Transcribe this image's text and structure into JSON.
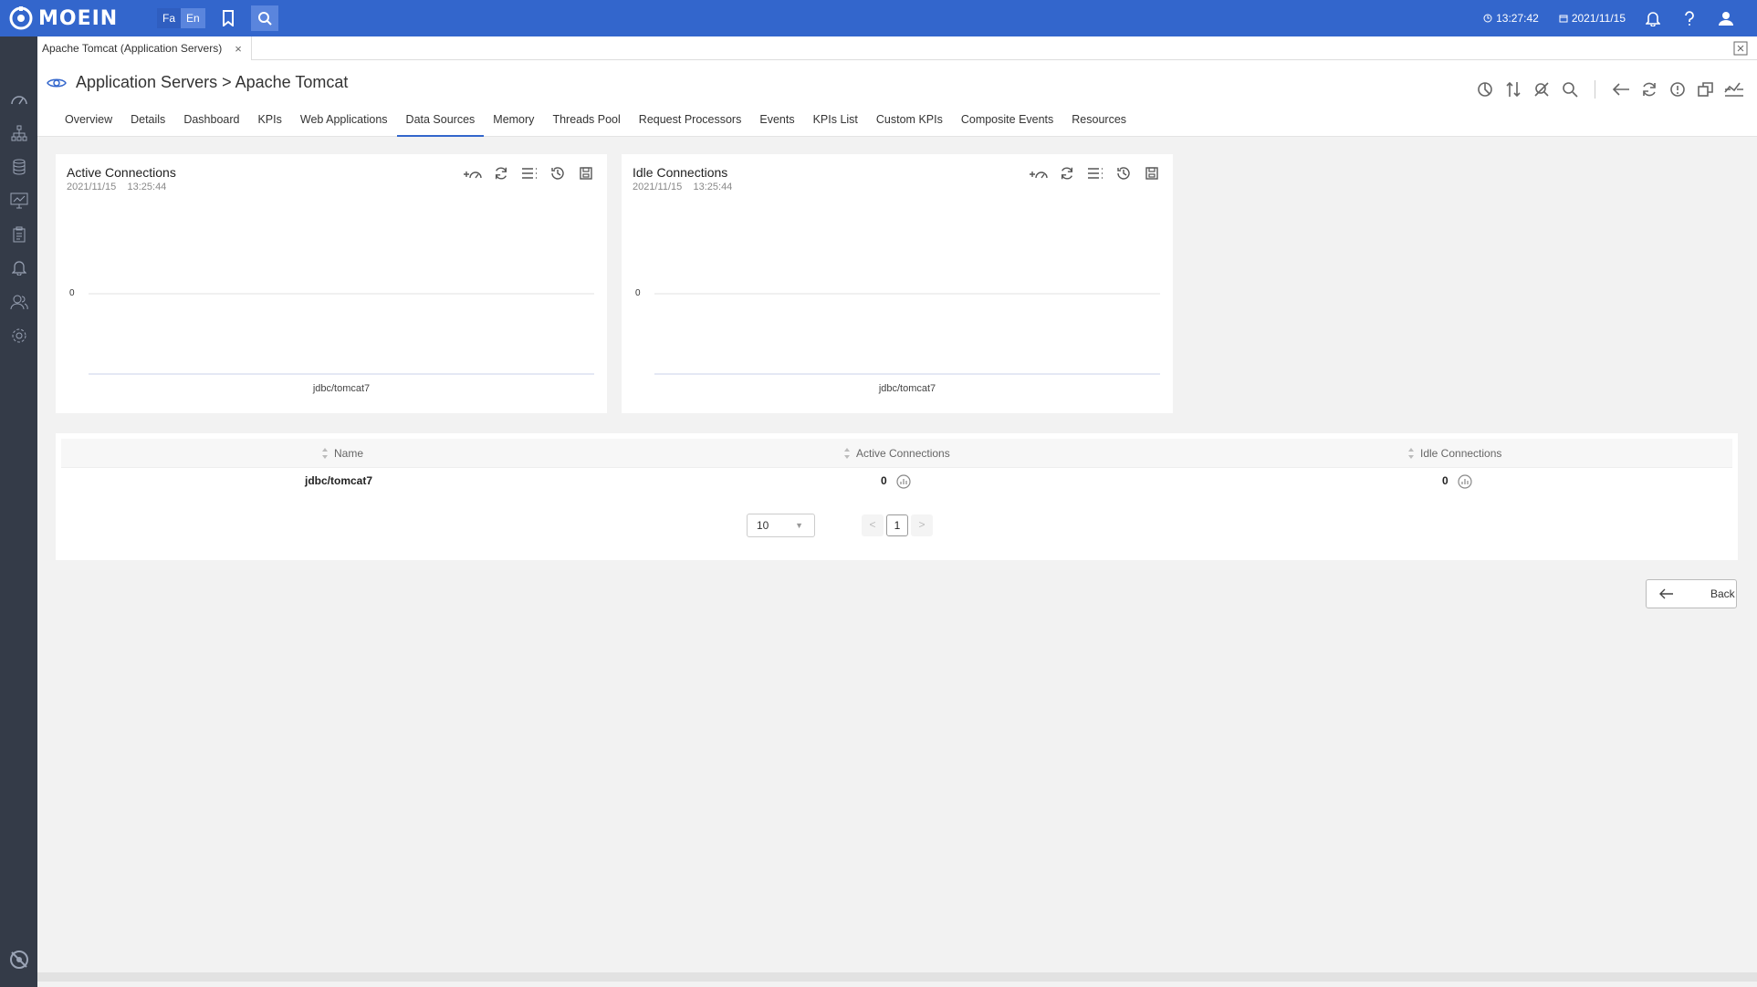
{
  "app": {
    "logo_text": "MOEIN"
  },
  "lang": {
    "fa": "Fa",
    "en": "En"
  },
  "topbar": {
    "time": "13:27:42",
    "date": "2021/11/15"
  },
  "doc_tab": {
    "label": "Apache Tomcat (Application Servers)",
    "close": "×"
  },
  "breadcrumb": "Application Servers > Apache Tomcat",
  "tabs": [
    "Overview",
    "Details",
    "Dashboard",
    "KPIs",
    "Web Applications",
    "Data Sources",
    "Memory",
    "Threads Pool",
    "Request Processors",
    "Events",
    "KPIs List",
    "Custom KPIs",
    "Composite Events",
    "Resources"
  ],
  "active_tab": "Data Sources",
  "charts": [
    {
      "title": "Active Connections",
      "date": "2021/11/15",
      "time": "13:25:44",
      "y_tick": "0",
      "x_label": "jdbc/tomcat7"
    },
    {
      "title": "Idle Connections",
      "date": "2021/11/15",
      "time": "13:25:44",
      "y_tick": "0",
      "x_label": "jdbc/tomcat7"
    }
  ],
  "chart_data": [
    {
      "type": "bar",
      "categories": [
        "jdbc/tomcat7"
      ],
      "values": [
        0
      ],
      "title": "Active Connections",
      "xlabel": "",
      "ylabel": "",
      "y_ticks": [
        0
      ],
      "grid": true
    },
    {
      "type": "bar",
      "categories": [
        "jdbc/tomcat7"
      ],
      "values": [
        0
      ],
      "title": "Idle Connections",
      "xlabel": "",
      "ylabel": "",
      "y_ticks": [
        0
      ],
      "grid": true
    }
  ],
  "table": {
    "columns": [
      "Name",
      "Active Connections",
      "Idle Connections"
    ],
    "rows": [
      {
        "name": "jdbc/tomcat7",
        "active": "0",
        "idle": "0"
      }
    ],
    "page_size": "10",
    "current_page": "1",
    "prev": "<",
    "next": ">"
  },
  "back_label": "Back",
  "colors": {
    "topbar": "#3366cc",
    "sidebar": "#343b48",
    "accent": "#3366cc"
  }
}
